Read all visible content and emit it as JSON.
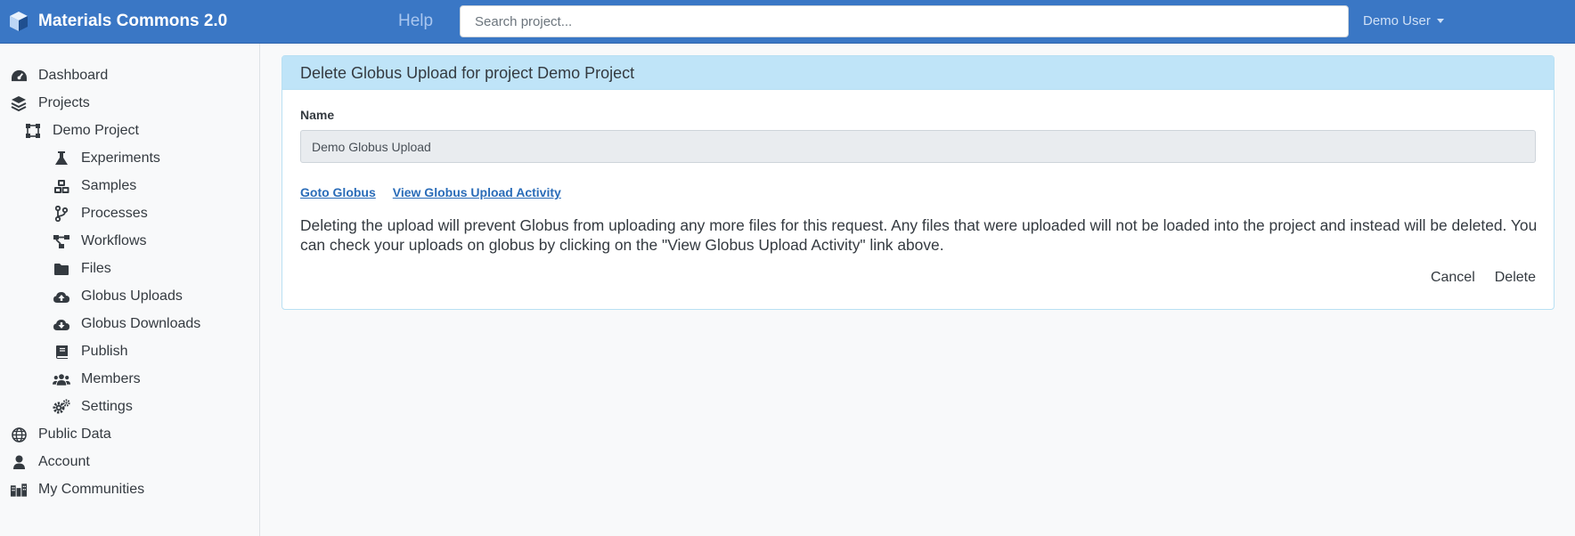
{
  "app": {
    "title": "Materials Commons 2.0",
    "logo_icon": "cube-icon",
    "accent": "#3a77c5"
  },
  "topbar": {
    "help_label": "Help",
    "search_placeholder": "Search project...",
    "user_label": "Demo User"
  },
  "sidebar": {
    "items": [
      {
        "label": "Dashboard",
        "icon": "tachometer-icon"
      },
      {
        "label": "Projects",
        "icon": "layers-icon"
      },
      {
        "label": "Demo Project",
        "icon": "project-diagram-icon"
      },
      {
        "label": "Experiments",
        "icon": "flask-icon"
      },
      {
        "label": "Samples",
        "icon": "cubes-icon"
      },
      {
        "label": "Processes",
        "icon": "code-branch-icon"
      },
      {
        "label": "Workflows",
        "icon": "workflow-icon"
      },
      {
        "label": "Files",
        "icon": "folder-icon"
      },
      {
        "label": "Globus Uploads",
        "icon": "cloud-upload-icon"
      },
      {
        "label": "Globus Downloads",
        "icon": "cloud-download-icon"
      },
      {
        "label": "Publish",
        "icon": "book-icon"
      },
      {
        "label": "Members",
        "icon": "users-icon"
      },
      {
        "label": "Settings",
        "icon": "cogs-icon"
      },
      {
        "label": "Public Data",
        "icon": "globe-icon"
      },
      {
        "label": "Account",
        "icon": "user-icon"
      },
      {
        "label": "My Communities",
        "icon": "city-icon"
      }
    ]
  },
  "card": {
    "title": "Delete Globus Upload for project Demo Project",
    "name_label": "Name",
    "name_value": "Demo Globus Upload",
    "goto_globus_label": "Goto Globus",
    "view_activity_label": "View Globus Upload Activity",
    "warning_text": "Deleting the upload will prevent Globus from uploading any more files for this request. Any files that were uploaded will not be loaded into the project and instead will be deleted. You can check your uploads on globus by clicking on the \"View Globus Upload Activity\" link above.",
    "cancel_label": "Cancel",
    "delete_label": "Delete"
  }
}
